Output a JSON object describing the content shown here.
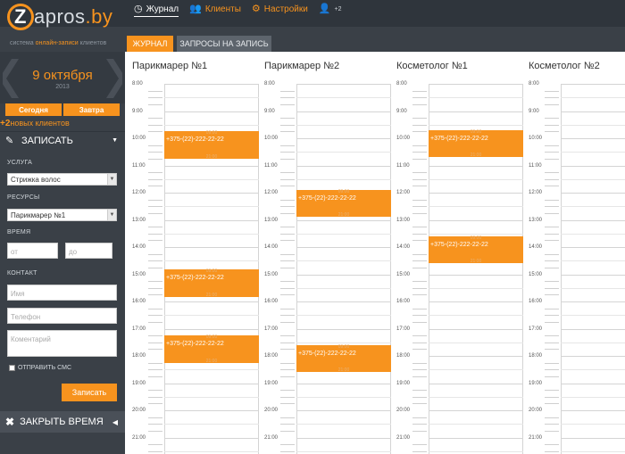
{
  "brand": {
    "logo_letter": "Z",
    "logo_main": "apros",
    "logo_tld": ".by",
    "tagline_pre": "система ",
    "tagline_accent": "онлайн-записи",
    "tagline_post": " клиентов"
  },
  "nav": {
    "journal": "Журнал",
    "clients": "Клиенты",
    "settings": "Настройки",
    "users_badge": "+2"
  },
  "tabs": {
    "journal": "ЖУРНАЛ",
    "requests": "ЗАПРОСЫ НА ЗАПИСЬ"
  },
  "sidebar": {
    "date": "9 октября",
    "year": "2013",
    "today": "Сегодня",
    "tomorrow": "Завтра",
    "new_clients_count": "+2",
    "new_clients_label": "новых клиентов",
    "write_title": "ЗАПИСАТЬ",
    "service_label": "УСЛУГА",
    "service_value": "Стрижка волос",
    "resources_label": "РЕСУРСЫ",
    "resource_value": "Парикмарер №1",
    "time_label": "ВРЕМЯ",
    "time_from_placeholder": "от",
    "time_to_placeholder": "до",
    "contact_label": "КОНТАКТ",
    "name_placeholder": "Имя",
    "phone_placeholder": "Телефон",
    "comment_placeholder": "Коментарий",
    "send_sms": "ОТПРАВИТЬ СМС",
    "submit": "Записать",
    "close_time": "ЗАКРЫТЬ ВРЕМЯ"
  },
  "calendar": {
    "columns": [
      {
        "title": "Парикмарер №1",
        "events": [
          {
            "start_hour": 9.75,
            "end_hour": 10.75,
            "phone": "+375-(22)-222-22-22",
            "t1": "09:00",
            "t2": "21:00"
          },
          {
            "start_hour": 14.83,
            "end_hour": 15.83,
            "phone": "+375-(22)-222-22-22",
            "t1": "09:00",
            "t2": "21:00"
          },
          {
            "start_hour": 17.25,
            "end_hour": 18.25,
            "phone": "+375-(22)-222-22-22",
            "t1": "09:00",
            "t2": "21:00"
          }
        ]
      },
      {
        "title": "Парикмарер №2",
        "events": [
          {
            "start_hour": 11.9,
            "end_hour": 12.9,
            "phone": "+375-(22)-222-22-22",
            "t1": "09:00",
            "t2": "21:00"
          },
          {
            "start_hour": 17.6,
            "end_hour": 18.6,
            "phone": "+375-(22)-222-22-22",
            "t1": "09:00",
            "t2": "21:00"
          }
        ]
      },
      {
        "title": "Косметолог №1",
        "events": [
          {
            "start_hour": 9.7,
            "end_hour": 10.7,
            "phone": "+375-(22)-222-22-22",
            "t1": "09:00",
            "t2": "21:00"
          },
          {
            "start_hour": 13.6,
            "end_hour": 14.6,
            "phone": "+375-(22)-222-22-22",
            "t1": "09:00",
            "t2": "21:00"
          }
        ]
      },
      {
        "title": "Косметолог №2",
        "events": []
      }
    ],
    "hours": [
      "8:00",
      "9:00",
      "10:00",
      "11:00",
      "12:00",
      "13:00",
      "14:00",
      "15:00",
      "16:00",
      "17:00",
      "18:00",
      "19:00",
      "20:00",
      "21:00"
    ]
  },
  "colors": {
    "accent": "#f7931e",
    "sidebar": "#3a4047",
    "topbar": "#2f353c"
  }
}
